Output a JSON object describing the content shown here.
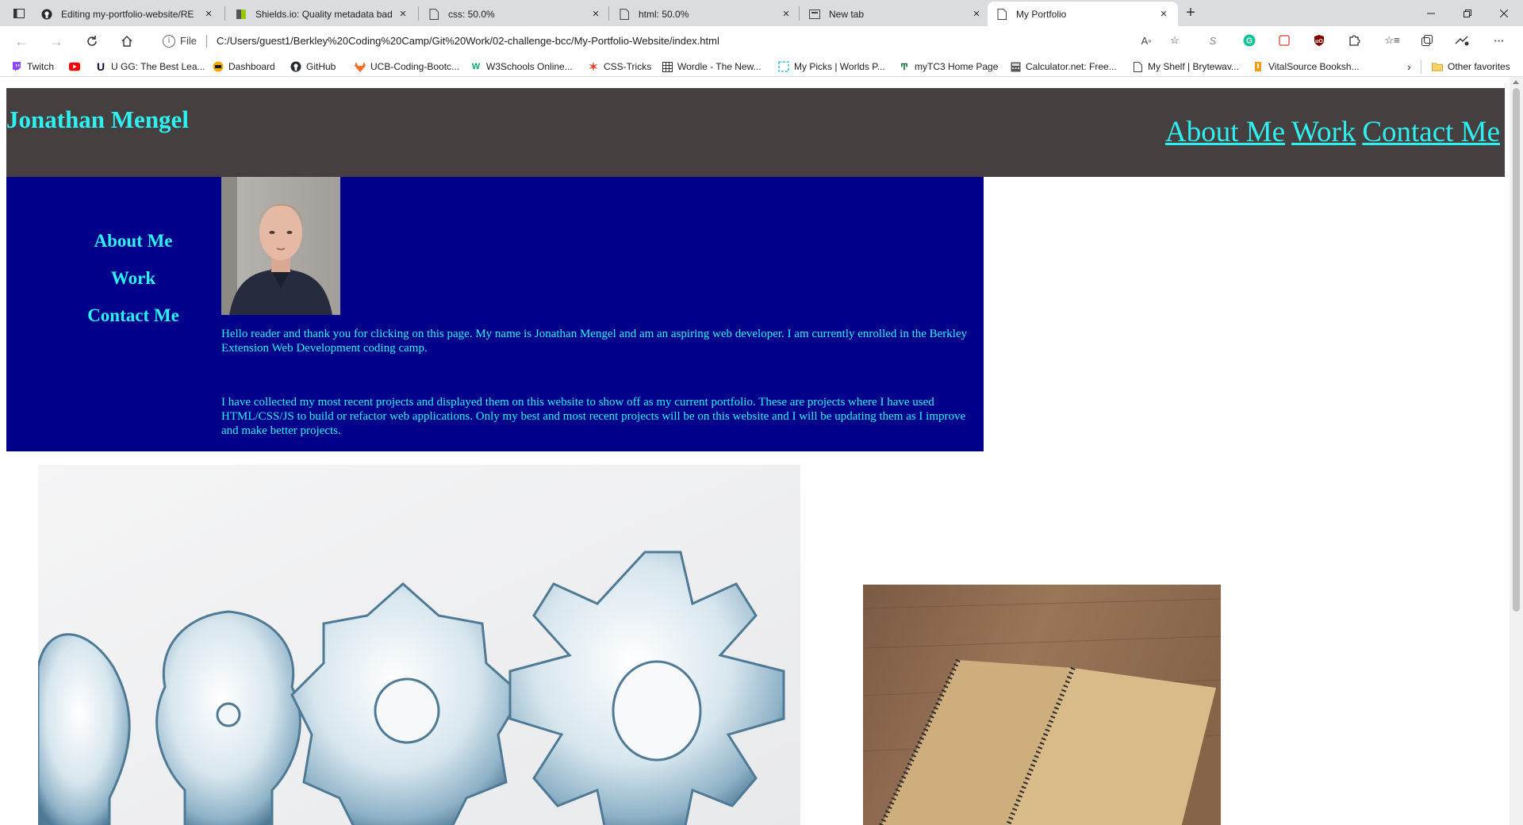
{
  "browser": {
    "tabs": [
      {
        "title": "Editing my-portfolio-website/RE",
        "icon": "github-icon",
        "active": false
      },
      {
        "title": "Shields.io: Quality metadata bad",
        "icon": "shields-icon",
        "active": false
      },
      {
        "title": "css: 50.0%",
        "icon": "document-icon",
        "active": false
      },
      {
        "title": "html: 50.0%",
        "icon": "document-icon",
        "active": false
      },
      {
        "title": "New tab",
        "icon": "newtab-icon",
        "active": false
      },
      {
        "title": "My Portfolio",
        "icon": "document-icon",
        "active": true
      }
    ],
    "address": {
      "scheme_label": "File",
      "url": "C:/Users/guest1/Berkley%20Coding%20Camp/Git%20Work/02-challenge-bcc/My-Portfolio-Website/index.html"
    },
    "bookmarks": [
      {
        "label": "Twitch",
        "icon": "twitch-icon"
      },
      {
        "label": "",
        "icon": "youtube-icon"
      },
      {
        "label": "U GG: The Best Lea...",
        "icon": "ugg-icon"
      },
      {
        "label": "Dashboard",
        "icon": "dashboard-icon"
      },
      {
        "label": "GitHub",
        "icon": "github-icon"
      },
      {
        "label": "UCB-Coding-Bootc...",
        "icon": "gitlab-icon"
      },
      {
        "label": "W3Schools Online...",
        "icon": "w3schools-icon"
      },
      {
        "label": "CSS-Tricks",
        "icon": "css-tricks-icon"
      },
      {
        "label": "Wordle - The New...",
        "icon": "wordle-icon"
      },
      {
        "label": "My Picks | Worlds P...",
        "icon": "picks-icon"
      },
      {
        "label": "myTC3 Home Page",
        "icon": "tc3-icon"
      },
      {
        "label": "Calculator.net: Free...",
        "icon": "calculator-icon"
      },
      {
        "label": "My Shelf | Brytewav...",
        "icon": "document-icon"
      },
      {
        "label": "VitalSource Booksh...",
        "icon": "vitalsource-icon"
      }
    ],
    "other_favorites": "Other favorites"
  },
  "page": {
    "header": {
      "title": "Jonathan Mengel",
      "nav": [
        "About Me",
        "Work",
        "Contact Me"
      ]
    },
    "side_nav": [
      "About Me",
      "Work",
      "Contact Me"
    ],
    "intro": {
      "paragraph1": "Hello reader and thank you for clicking on this page. My name is Jonathan Mengel and am an aspiring web developer. I am currently enrolled in the Berkley Extension Web Development coding camp.",
      "paragraph2": "I have collected my most recent projects and displayed them on this website to show off as my current portfolio. These are projects where I have used HTML/CSS/JS to build or refactor web applications. Only my best and most recent projects will be on this website and I will be updating them as I improve and make better projects."
    }
  },
  "colors": {
    "header_bg": "#453f3f",
    "hero_bg": "#01008b",
    "accent_text": "#2ff0f0"
  }
}
